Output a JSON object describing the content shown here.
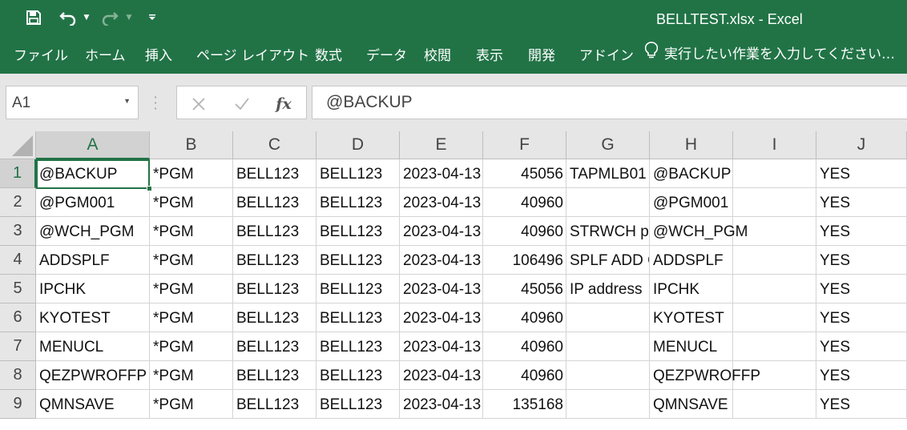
{
  "window": {
    "title": "BELLTEST.xlsx - Excel"
  },
  "quick_access": {
    "icons": [
      "save-icon",
      "undo-icon",
      "redo-icon",
      "customize-icon"
    ]
  },
  "ribbon": {
    "tabs": [
      "ファイル",
      "ホーム",
      "挿入",
      "ページ レイアウト",
      "数式",
      "データ",
      "校閲",
      "表示",
      "開発",
      "アドイン"
    ],
    "tell_me": "実行したい作業を入力してください…"
  },
  "formula_bar": {
    "name_box": "A1",
    "formula": "@BACKUP"
  },
  "grid": {
    "columns": [
      "A",
      "B",
      "C",
      "D",
      "E",
      "F",
      "G",
      "H",
      "I",
      "J"
    ],
    "rows": [
      "1",
      "2",
      "3",
      "4",
      "5",
      "6",
      "7",
      "8",
      "9"
    ],
    "active_cell": "A1",
    "cells": [
      [
        "@BACKUP",
        "*PGM",
        "BELL123",
        "BELL123",
        "2023-04-13",
        "45056",
        "TAPMLB01",
        "@BACKUP",
        "",
        "YES"
      ],
      [
        "@PGM001",
        "*PGM",
        "BELL123",
        "BELL123",
        "2023-04-13",
        "40960",
        "",
        "@PGM001",
        "",
        "YES"
      ],
      [
        "@WCH_PGM",
        "*PGM",
        "BELL123",
        "BELL123",
        "2023-04-13",
        "40960",
        "STRWCH pr",
        "@WCH_PGM",
        "",
        "YES"
      ],
      [
        "ADDSPLF",
        "*PGM",
        "BELL123",
        "BELL123",
        "2023-04-13",
        "106496",
        "SPLF ADD C",
        "ADDSPLF",
        "",
        "YES"
      ],
      [
        "IPCHK",
        "*PGM",
        "BELL123",
        "BELL123",
        "2023-04-13",
        "45056",
        "IP address",
        "IPCHK",
        "",
        "YES"
      ],
      [
        "KYOTEST",
        "*PGM",
        "BELL123",
        "BELL123",
        "2023-04-13",
        "40960",
        "",
        "KYOTEST",
        "",
        "YES"
      ],
      [
        "MENUCL",
        "*PGM",
        "BELL123",
        "BELL123",
        "2023-04-13",
        "40960",
        "",
        "MENUCL",
        "",
        "YES"
      ],
      [
        "QEZPWROFFP",
        "*PGM",
        "BELL123",
        "BELL123",
        "2023-04-13",
        "40960",
        "",
        "QEZPWROFFP",
        "",
        "YES"
      ],
      [
        "QMNSAVE",
        "*PGM",
        "BELL123",
        "BELL123",
        "2023-04-13",
        "135168",
        "",
        "QMNSAVE",
        "",
        "YES"
      ]
    ]
  },
  "colors": {
    "accent": "#217346",
    "header_bg": "#e6e6e6",
    "gridline": "#d4d4d4"
  }
}
